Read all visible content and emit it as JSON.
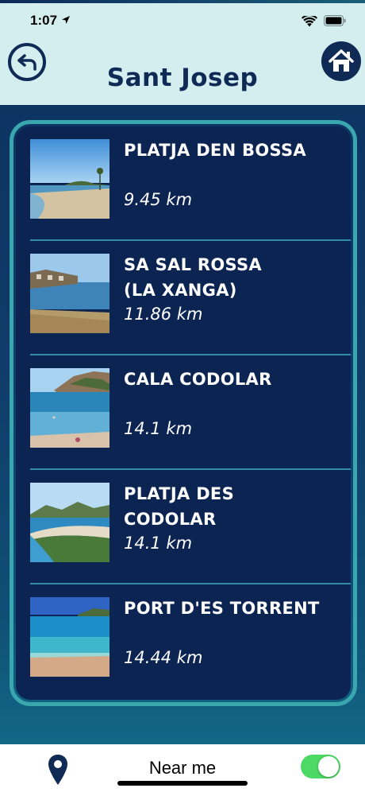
{
  "status_bar": {
    "time": "1:07",
    "icons": [
      "location-arrow-icon",
      "wifi-icon",
      "battery-icon"
    ]
  },
  "header": {
    "title": "Sant Josep",
    "back_icon": "back-arrow-icon",
    "home_icon": "home-icon"
  },
  "beaches": [
    {
      "name": "PLATJA DEN BOSSA",
      "distance": "9.45 km"
    },
    {
      "name": "SA SAL ROSSA\n(LA XANGA)",
      "distance": "11.86 km"
    },
    {
      "name": "CALA CODOLAR",
      "distance": "14.1 km"
    },
    {
      "name": "PLATJA DES\nCODOLAR",
      "distance": "14.1 km"
    },
    {
      "name": "PORT D'ES TORRENT",
      "distance": "14.44 km"
    }
  ],
  "bottom_bar": {
    "label": "Near me",
    "pin_icon": "location-pin-icon",
    "toggle_on": true
  },
  "colors": {
    "header_bg": "#d4eef0",
    "navy": "#0f2a55",
    "frame_teal": "#3aa6ad",
    "list_bg": "#0b2452",
    "toggle_green": "#4cd964"
  }
}
